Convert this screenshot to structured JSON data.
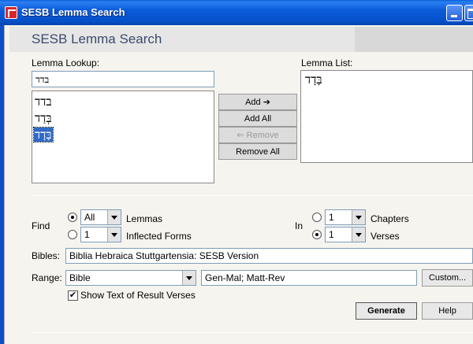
{
  "window": {
    "title": "SESB Lemma Search"
  },
  "header": {
    "title": "SESB Lemma Search"
  },
  "lookup": {
    "label_pre": "",
    "label": "Lemma Lookup:",
    "query": "בדד",
    "results": [
      "בדד",
      "בְּדַד",
      "בָּדָד"
    ],
    "selected_index": 2
  },
  "lemma_list": {
    "label": "Lemma List:",
    "items": [
      "בָּדָד"
    ]
  },
  "middle_buttons": {
    "add": "Add ➔",
    "add_all": "Add All",
    "remove": "⇐ Remove",
    "remove_all": "Remove All"
  },
  "find": {
    "label": "Find",
    "all_value": "All",
    "lemmas_label": "Lemmas",
    "inflected_value": "1",
    "inflected_label": "Inflected Forms"
  },
  "in": {
    "label": "In",
    "chapters_value": "1",
    "chapters_label": "Chapters",
    "verses_value": "1",
    "verses_label": "Verses"
  },
  "bibles": {
    "label": "Bibles:",
    "value": "Biblia Hebraica Stuttgartensia: SESB Version"
  },
  "range": {
    "label": "Range:",
    "value": "Bible",
    "text": "Gen-Mal; Matt-Rev",
    "custom_label": "Custom..."
  },
  "show_text": {
    "label": "Show Text of Result Verses",
    "checked_mark": "✔"
  },
  "footer": {
    "generate": "Generate",
    "help": "Help"
  }
}
